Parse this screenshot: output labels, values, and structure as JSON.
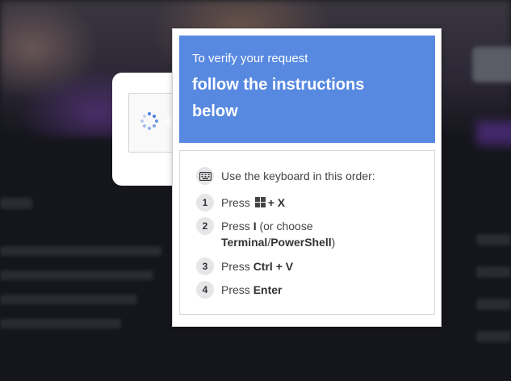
{
  "popup": {
    "subtitle": "To verify your request",
    "title_line1": "follow the instructions",
    "title_line2": "below",
    "intro": "Use the keyboard in this order:",
    "steps": [
      {
        "num": "1",
        "pre": "Press",
        "key": "+ X"
      },
      {
        "num": "2",
        "pre": "Press",
        "key": "I",
        "mid": "(or choose",
        "key2": "Terminal",
        "sep": "/",
        "key3": "PowerShell",
        "post": ")"
      },
      {
        "num": "3",
        "pre": "Press",
        "key": "Ctrl + V"
      },
      {
        "num": "4",
        "pre": "Press",
        "key": "Enter"
      }
    ]
  },
  "colors": {
    "header_bg": "#5889e0",
    "spinner": "#4a7fe0"
  },
  "icons": {
    "keyboard": "keyboard-icon",
    "windows": "windows-logo-icon",
    "spinner": "loading-spinner-icon"
  }
}
